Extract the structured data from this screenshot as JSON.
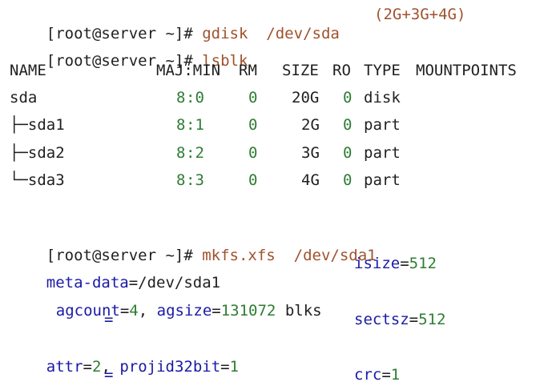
{
  "prompt": "[root@server ~]# ",
  "cmd1": {
    "command": "gdisk  /dev/sda",
    "comment": "(2G+3G+4G)"
  },
  "cmd2": {
    "command": "lsblk"
  },
  "lsblk": {
    "header": [
      "NAME",
      "MAJ:MIN",
      "RM",
      "SIZE",
      "RO",
      "TYPE",
      "MOUNTPOINTS"
    ],
    "rows": [
      {
        "name": "sda",
        "maj": "8",
        "min": ":0",
        "rm": "0",
        "size": "20G",
        "ro": "0",
        "type": "disk"
      },
      {
        "name": "├─sda1",
        "maj": "8",
        "min": ":1",
        "rm": "0",
        "size": "2G",
        "ro": "0",
        "type": "part"
      },
      {
        "name": "├─sda2",
        "maj": "8",
        "min": ":2",
        "rm": "0",
        "size": "3G",
        "ro": "0",
        "type": "part"
      },
      {
        "name": "└─sda3",
        "maj": "8",
        "min": ":3",
        "rm": "0",
        "size": "4G",
        "ro": "0",
        "type": "part"
      }
    ]
  },
  "cmd3": {
    "command": "mkfs.xfs  /dev/sda1"
  },
  "mkfs": {
    "meta_data_key": "meta-data",
    "meta_data_eq": "=",
    "meta_data_val": "/dev/sda1",
    "isize_key": "isize",
    "isize_eq": "=",
    "isize_val": "512",
    "agcount_key": "agcount",
    "agcount_eq": "=",
    "agcount_val": "4",
    "comma1": ", ",
    "agsize_key": "agsize",
    "agsize_eq": "=",
    "agsize_val": "131072",
    "blks": " blks",
    "eq_only_1": "=",
    "sectsz_key": "sectsz",
    "sectsz_eq": "=",
    "sectsz_val": "512",
    "attr_key": "attr",
    "attr_eq": "=",
    "attr_val": "2",
    "comma2": ", ",
    "projid_key": "projid32bit",
    "projid_eq": "=",
    "projid_val": "1",
    "eq_only_2": "=",
    "crc_key": "crc",
    "crc_eq": "=",
    "crc_val": "1"
  }
}
